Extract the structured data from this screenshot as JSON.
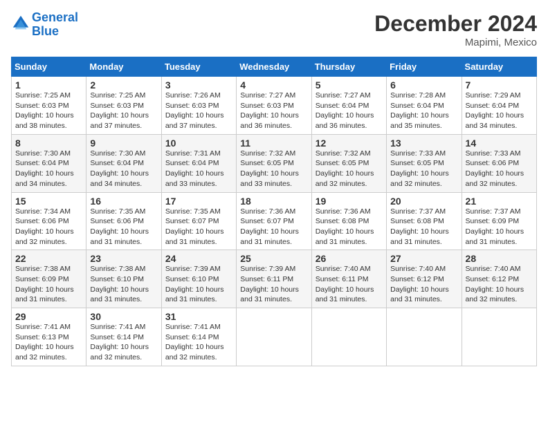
{
  "header": {
    "logo_line1": "General",
    "logo_line2": "Blue",
    "title": "December 2024",
    "subtitle": "Mapimi, Mexico"
  },
  "days": [
    "Sunday",
    "Monday",
    "Tuesday",
    "Wednesday",
    "Thursday",
    "Friday",
    "Saturday"
  ],
  "weeks": [
    [
      {
        "date": "1",
        "rise": "7:25 AM",
        "set": "6:03 PM",
        "daylight": "10 hours and 38 minutes."
      },
      {
        "date": "2",
        "rise": "7:25 AM",
        "set": "6:03 PM",
        "daylight": "10 hours and 37 minutes."
      },
      {
        "date": "3",
        "rise": "7:26 AM",
        "set": "6:03 PM",
        "daylight": "10 hours and 37 minutes."
      },
      {
        "date": "4",
        "rise": "7:27 AM",
        "set": "6:03 PM",
        "daylight": "10 hours and 36 minutes."
      },
      {
        "date": "5",
        "rise": "7:27 AM",
        "set": "6:04 PM",
        "daylight": "10 hours and 36 minutes."
      },
      {
        "date": "6",
        "rise": "7:28 AM",
        "set": "6:04 PM",
        "daylight": "10 hours and 35 minutes."
      },
      {
        "date": "7",
        "rise": "7:29 AM",
        "set": "6:04 PM",
        "daylight": "10 hours and 34 minutes."
      }
    ],
    [
      {
        "date": "8",
        "rise": "7:30 AM",
        "set": "6:04 PM",
        "daylight": "10 hours and 34 minutes."
      },
      {
        "date": "9",
        "rise": "7:30 AM",
        "set": "6:04 PM",
        "daylight": "10 hours and 34 minutes."
      },
      {
        "date": "10",
        "rise": "7:31 AM",
        "set": "6:04 PM",
        "daylight": "10 hours and 33 minutes."
      },
      {
        "date": "11",
        "rise": "7:32 AM",
        "set": "6:05 PM",
        "daylight": "10 hours and 33 minutes."
      },
      {
        "date": "12",
        "rise": "7:32 AM",
        "set": "6:05 PM",
        "daylight": "10 hours and 32 minutes."
      },
      {
        "date": "13",
        "rise": "7:33 AM",
        "set": "6:05 PM",
        "daylight": "10 hours and 32 minutes."
      },
      {
        "date": "14",
        "rise": "7:33 AM",
        "set": "6:06 PM",
        "daylight": "10 hours and 32 minutes."
      }
    ],
    [
      {
        "date": "15",
        "rise": "7:34 AM",
        "set": "6:06 PM",
        "daylight": "10 hours and 32 minutes."
      },
      {
        "date": "16",
        "rise": "7:35 AM",
        "set": "6:06 PM",
        "daylight": "10 hours and 31 minutes."
      },
      {
        "date": "17",
        "rise": "7:35 AM",
        "set": "6:07 PM",
        "daylight": "10 hours and 31 minutes."
      },
      {
        "date": "18",
        "rise": "7:36 AM",
        "set": "6:07 PM",
        "daylight": "10 hours and 31 minutes."
      },
      {
        "date": "19",
        "rise": "7:36 AM",
        "set": "6:08 PM",
        "daylight": "10 hours and 31 minutes."
      },
      {
        "date": "20",
        "rise": "7:37 AM",
        "set": "6:08 PM",
        "daylight": "10 hours and 31 minutes."
      },
      {
        "date": "21",
        "rise": "7:37 AM",
        "set": "6:09 PM",
        "daylight": "10 hours and 31 minutes."
      }
    ],
    [
      {
        "date": "22",
        "rise": "7:38 AM",
        "set": "6:09 PM",
        "daylight": "10 hours and 31 minutes."
      },
      {
        "date": "23",
        "rise": "7:38 AM",
        "set": "6:10 PM",
        "daylight": "10 hours and 31 minutes."
      },
      {
        "date": "24",
        "rise": "7:39 AM",
        "set": "6:10 PM",
        "daylight": "10 hours and 31 minutes."
      },
      {
        "date": "25",
        "rise": "7:39 AM",
        "set": "6:11 PM",
        "daylight": "10 hours and 31 minutes."
      },
      {
        "date": "26",
        "rise": "7:40 AM",
        "set": "6:11 PM",
        "daylight": "10 hours and 31 minutes."
      },
      {
        "date": "27",
        "rise": "7:40 AM",
        "set": "6:12 PM",
        "daylight": "10 hours and 31 minutes."
      },
      {
        "date": "28",
        "rise": "7:40 AM",
        "set": "6:12 PM",
        "daylight": "10 hours and 32 minutes."
      }
    ],
    [
      {
        "date": "29",
        "rise": "7:41 AM",
        "set": "6:13 PM",
        "daylight": "10 hours and 32 minutes."
      },
      {
        "date": "30",
        "rise": "7:41 AM",
        "set": "6:14 PM",
        "daylight": "10 hours and 32 minutes."
      },
      {
        "date": "31",
        "rise": "7:41 AM",
        "set": "6:14 PM",
        "daylight": "10 hours and 32 minutes."
      },
      null,
      null,
      null,
      null
    ]
  ]
}
